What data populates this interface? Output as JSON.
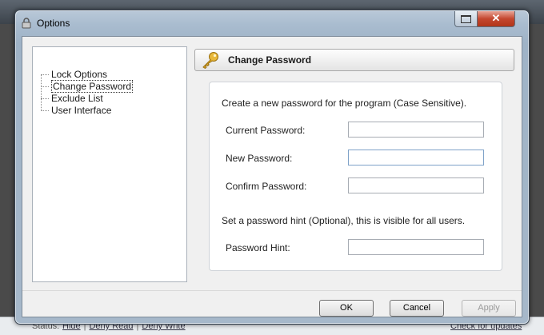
{
  "window": {
    "title": "Options"
  },
  "tree": {
    "items": [
      {
        "label": "Lock Options",
        "selected": false
      },
      {
        "label": "Change Password",
        "selected": true
      },
      {
        "label": "Exclude List",
        "selected": false
      },
      {
        "label": "User Interface",
        "selected": false
      }
    ]
  },
  "section": {
    "title": "Change Password",
    "icon": "key-icon",
    "intro": "Create a new password for the program (Case Sensitive).",
    "fields": {
      "current": {
        "label": "Current Password:",
        "value": ""
      },
      "new": {
        "label": "New Password:",
        "value": ""
      },
      "confirm": {
        "label": "Confirm Password:",
        "value": ""
      },
      "hint": {
        "label": "Password Hint:",
        "value": ""
      }
    },
    "hint_note": "Set a password hint (Optional), this is visible for all users."
  },
  "buttons": {
    "ok": "OK",
    "cancel": "Cancel",
    "apply": "Apply"
  },
  "status_bar": {
    "label": "Status:",
    "links": [
      "Hide",
      "Deny Read",
      "Deny Write"
    ],
    "right_link": "Check for updates"
  },
  "colors": {
    "title_bar": "#a9bccf",
    "close_button": "#c4472f",
    "client_bg": "#f0f0f0"
  }
}
